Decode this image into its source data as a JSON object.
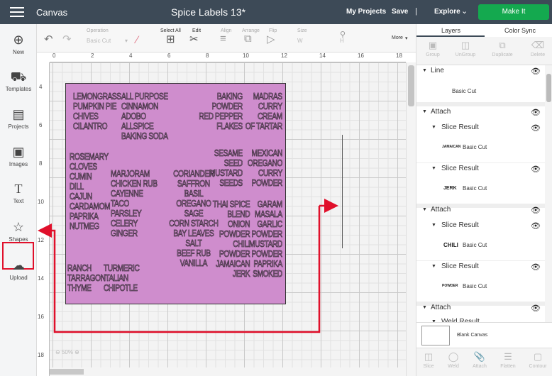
{
  "topbar": {
    "app": "Canvas",
    "title": "Spice Labels 13*",
    "my_projects": "My Projects",
    "save": "Save",
    "sep": "|",
    "explore": "Explore",
    "make_it": "Make It"
  },
  "leftnav": {
    "new": "New",
    "templates": "Templates",
    "projects": "Projects",
    "images": "Images",
    "text": "Text",
    "shapes": "Shapes",
    "upload": "Upload"
  },
  "toolbar": {
    "operation": "Operation",
    "operation_value": "Basic Cut",
    "select_all": "Select All",
    "edit": "Edit",
    "align": "Align",
    "arrange": "Arrange",
    "flip": "Flip",
    "size": "Size",
    "w": "W",
    "h": "H",
    "more": "More"
  },
  "ruler": {
    "x": [
      "0",
      "2",
      "4",
      "6",
      "8",
      "10",
      "12",
      "14",
      "16",
      "18"
    ],
    "y": [
      "4",
      "6",
      "8",
      "10",
      "12",
      "14",
      "16",
      "18"
    ]
  },
  "zoom": "50%",
  "labels": {
    "c1a": "LEMONGRASS\nPUMPKIN PIE\nCHIVES\nCILANTRO",
    "c1b": "ROSEMARY\nCLOVES\nCUMIN\nDILL\nCAJUN\nCARDAMOM\nPAPRIKA\nNUTMEG",
    "c1c": "RANCH\nTARRAGON\nTHYME",
    "c2a": "ALL PURPOSE\nCINNAMON\nADOBO\nALLSPICE\nBAKING SODA",
    "c2b": "MARJORAM\nCHICKEN RUB\nCAYENNE\nTACO\nPARSLEY\nCELERY\nGINGER",
    "c2c": "TURMERIC\nITALIAN\nCHIPOTLE",
    "c3a": "CORIANDER\nSAFFRON\nBASIL\nOREGANO\nSAGE\nCORN STARCH\nBAY LEAVES\nSALT\nBEEF RUB\nVANILLA",
    "c4a": "BAKING\nPOWDER\nRED PEPPER\nFLAKES",
    "c4b": "SESAME\nSEED\nMUSTARD\nSEEDS",
    "c4c": "THAI SPICE\nBLEND\nONION\nPOWDER\nCHILI\nPOWDER\nJAMAICAN\nJERK",
    "c5a": "MADRAS\nCURRY\nCREAM\nOF TARTAR",
    "c5b": "MEXICAN\nOREGANO\nCURRY\nPOWDER",
    "c5c": "GARAM\nMASALA\nGARLIC\nPOWDER\nMUSTARD\nPOWDER\nPAPRIKA\nSMOKED"
  },
  "panel": {
    "tab_layers": "Layers",
    "tab_color_sync": "Color Sync",
    "actions": [
      "Group",
      "UnGroup",
      "Duplicate",
      "Delete"
    ],
    "bottom_actions": [
      "Slice",
      "Weld",
      "Attach",
      "Flatten",
      "Contour"
    ],
    "line": "Line",
    "basic_cut": "Basic Cut",
    "attach": "Attach",
    "slice_result": "Slice Result",
    "weld_result": "Weld Result",
    "thumbs": [
      "JAMAICAN",
      "JERK",
      "CHILI",
      "POWDER"
    ],
    "blank_canvas": "Blank Canvas"
  },
  "colors": {
    "topbar": "#3d4a57",
    "make_it": "#14a94f",
    "mat": "#cf8dcd",
    "annotation": "#e0102b"
  }
}
